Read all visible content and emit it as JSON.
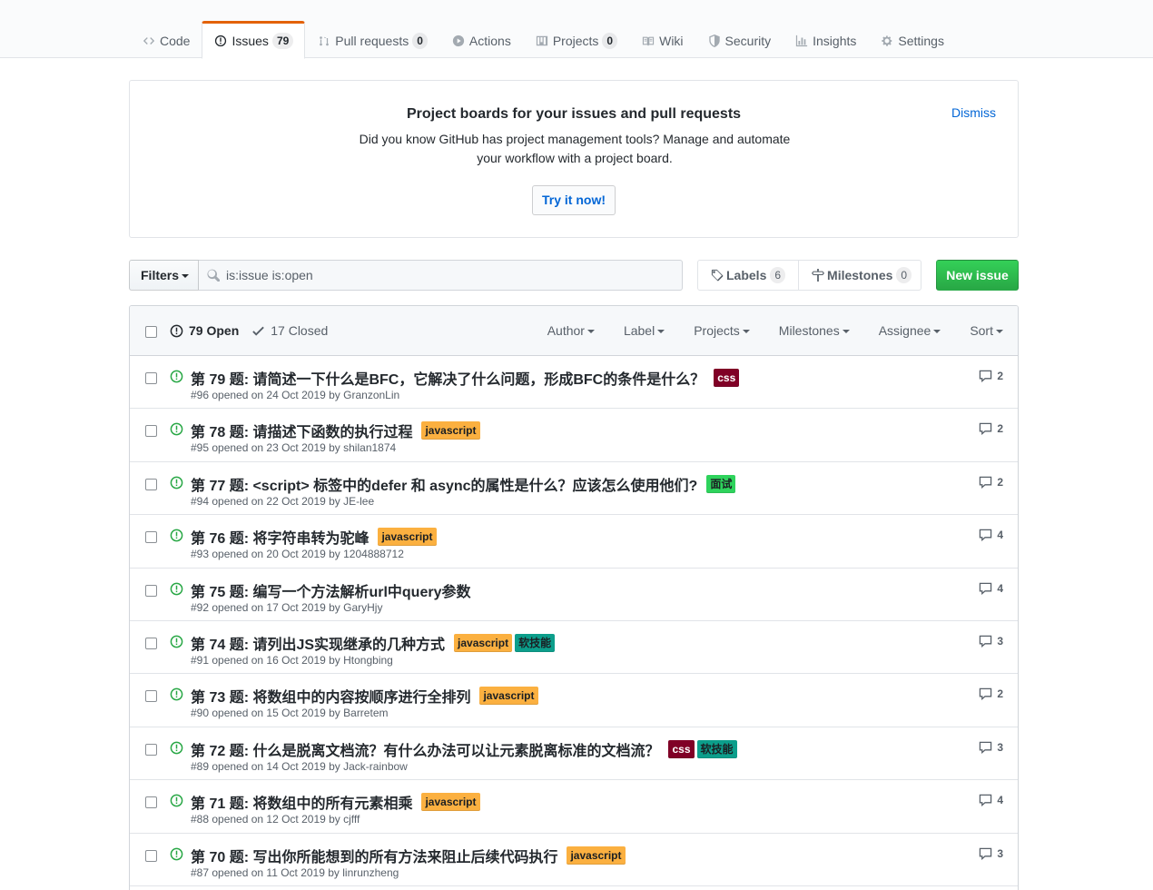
{
  "nav": {
    "tabs": [
      {
        "label": "Code",
        "icon": "code-icon",
        "count": null,
        "active": false
      },
      {
        "label": "Issues",
        "icon": "issue-opened-icon",
        "count": "79",
        "active": true
      },
      {
        "label": "Pull requests",
        "icon": "git-pull-request-icon",
        "count": "0",
        "active": false
      },
      {
        "label": "Actions",
        "icon": "play-icon",
        "count": null,
        "active": false
      },
      {
        "label": "Projects",
        "icon": "project-icon",
        "count": "0",
        "active": false
      },
      {
        "label": "Wiki",
        "icon": "book-icon",
        "count": null,
        "active": false
      },
      {
        "label": "Security",
        "icon": "shield-icon",
        "count": null,
        "active": false
      },
      {
        "label": "Insights",
        "icon": "graph-icon",
        "count": null,
        "active": false
      },
      {
        "label": "Settings",
        "icon": "gear-icon",
        "count": null,
        "active": false
      }
    ]
  },
  "banner": {
    "title": "Project boards for your issues and pull requests",
    "line1": "Did you know GitHub has project management tools? Manage and automate",
    "line2": "your workflow with a project board.",
    "dismiss": "Dismiss",
    "try_button": "Try it now!"
  },
  "filters": {
    "button": "Filters",
    "search_value": "is:issue is:open",
    "labels": "Labels",
    "labels_count": "6",
    "milestones": "Milestones",
    "milestones_count": "0",
    "new_issue": "New issue"
  },
  "list_header": {
    "open": "79 Open",
    "closed": "17 Closed",
    "sorts": [
      "Author",
      "Label",
      "Projects",
      "Milestones",
      "Assignee",
      "Sort"
    ]
  },
  "colors": {
    "open_green": "#28a745",
    "css_label": "#800026",
    "javascript_label": "#fbb040",
    "interview_label": "#2ed35c",
    "soft_skill_label": "#0c9e8b"
  },
  "issues": [
    {
      "title": "第 79 题: 请简述一下什么是BFC，它解决了什么问题，形成BFC的条件是什么？",
      "labels": [
        {
          "text": "css",
          "kind": "css"
        }
      ],
      "meta": "#96 opened on 24 Oct 2019 by GranzonLin",
      "comments": "2"
    },
    {
      "title": "第 78 题: 请描述下函数的执行过程",
      "labels": [
        {
          "text": "javascript",
          "kind": "js"
        }
      ],
      "meta": "#95 opened on 23 Oct 2019 by shilan1874",
      "comments": "2"
    },
    {
      "title": "第 77 题: <script> 标签中的defer 和 async的属性是什么？应该怎么使用他们?",
      "labels": [
        {
          "text": "面试",
          "kind": "interview"
        }
      ],
      "meta": "#94 opened on 22 Oct 2019 by JE-lee",
      "comments": "2"
    },
    {
      "title": "第 76 题: 将字符串转为驼峰",
      "labels": [
        {
          "text": "javascript",
          "kind": "js"
        }
      ],
      "meta": "#93 opened on 20 Oct 2019 by 1204888712",
      "comments": "4"
    },
    {
      "title": "第 75 题: 编写一个方法解析url中query参数",
      "labels": [],
      "meta": "#92 opened on 17 Oct 2019 by GaryHjy",
      "comments": "4"
    },
    {
      "title": "第 74 题: 请列出JS实现继承的几种方式",
      "labels": [
        {
          "text": "javascript",
          "kind": "js"
        },
        {
          "text": "软技能",
          "kind": "soft"
        }
      ],
      "meta": "#91 opened on 16 Oct 2019 by Htongbing",
      "comments": "3"
    },
    {
      "title": "第 73 题: 将数组中的内容按顺序进行全排列",
      "labels": [
        {
          "text": "javascript",
          "kind": "js"
        }
      ],
      "meta": "#90 opened on 15 Oct 2019 by Barretem",
      "comments": "2"
    },
    {
      "title": "第 72 题: 什么是脱离文档流？有什么办法可以让元素脱离标准的文档流？",
      "labels": [
        {
          "text": "css",
          "kind": "css"
        },
        {
          "text": "软技能",
          "kind": "soft"
        }
      ],
      "meta": "#89 opened on 14 Oct 2019 by Jack-rainbow",
      "comments": "3"
    },
    {
      "title": "第 71 题: 将数组中的所有元素相乘",
      "labels": [
        {
          "text": "javascript",
          "kind": "js"
        }
      ],
      "meta": "#88 opened on 12 Oct 2019 by cjfff",
      "comments": "4"
    },
    {
      "title": "第 70 题: 写出你所能想到的所有方法来阻止后续代码执行",
      "labels": [
        {
          "text": "javascript",
          "kind": "js"
        }
      ],
      "meta": "#87 opened on 11 Oct 2019 by linrunzheng",
      "comments": "3"
    }
  ]
}
